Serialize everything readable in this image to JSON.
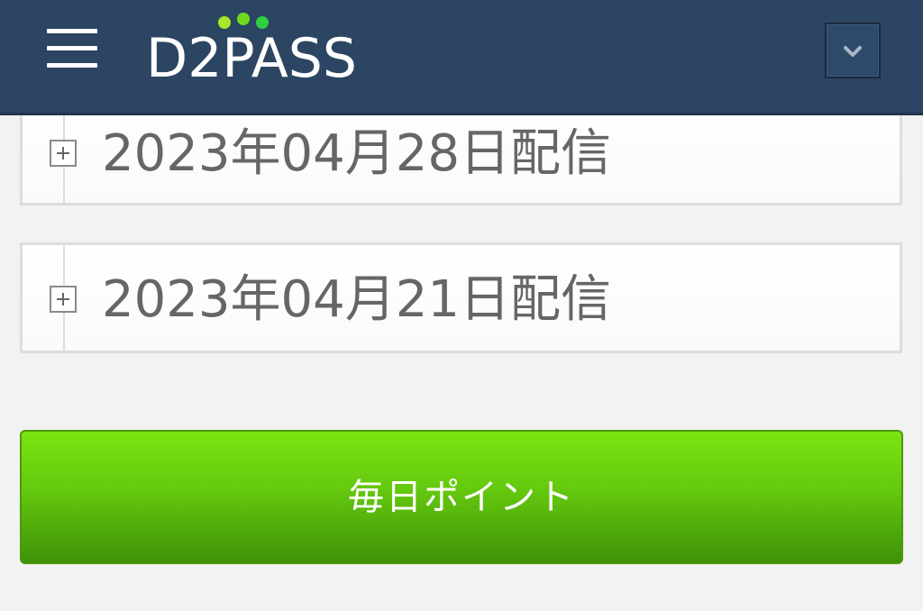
{
  "header": {
    "menu_icon": "hamburger-menu-icon",
    "logo": {
      "text": "D2PASS",
      "dot_colors": [
        "#a6e82a",
        "#6ddc1e",
        "#2fcf3f"
      ]
    },
    "dropdown_icon": "chevron-down-icon",
    "background_color": "#2c4563"
  },
  "archive": {
    "expand_icon": "plus-box-icon",
    "items": [
      {
        "label": "2023年04月28日配信"
      },
      {
        "label": "2023年04月21日配信"
      }
    ]
  },
  "daily_points": {
    "label": "毎日ポイント",
    "color": "#64c80e"
  }
}
